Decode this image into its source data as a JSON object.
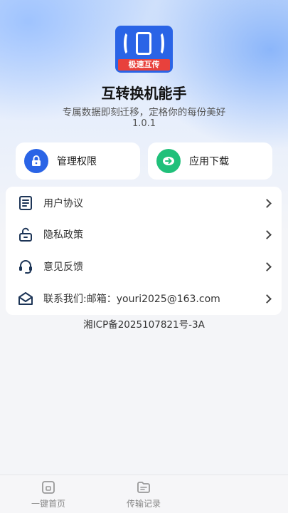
{
  "app": {
    "logo_text": "极速互传",
    "title": "互转换机能手",
    "subtitle": "专属数据即刻迁移，定格你的每份美好",
    "version": "1.0.1"
  },
  "quick_actions": {
    "permissions_label": "管理权限",
    "download_label": "应用下载"
  },
  "menu": {
    "items": [
      {
        "label": "用户协议",
        "icon": "document-icon"
      },
      {
        "label": "隐私政策",
        "icon": "unlock-icon"
      },
      {
        "label": "意见反馈",
        "icon": "headset-icon"
      },
      {
        "label": "联系我们:邮箱：youri2025@163.com",
        "icon": "mail-icon"
      }
    ]
  },
  "footer": {
    "icp": "湘ICP备2025107821号-3A"
  },
  "tabbar": {
    "tabs": [
      {
        "label": "一键首页",
        "icon": "home-icon"
      },
      {
        "label": "传输记录",
        "icon": "folder-icon"
      }
    ]
  },
  "colors": {
    "accent": "#2a64e6",
    "logo_band": "#e8413c",
    "download_green": "#20c07a"
  }
}
